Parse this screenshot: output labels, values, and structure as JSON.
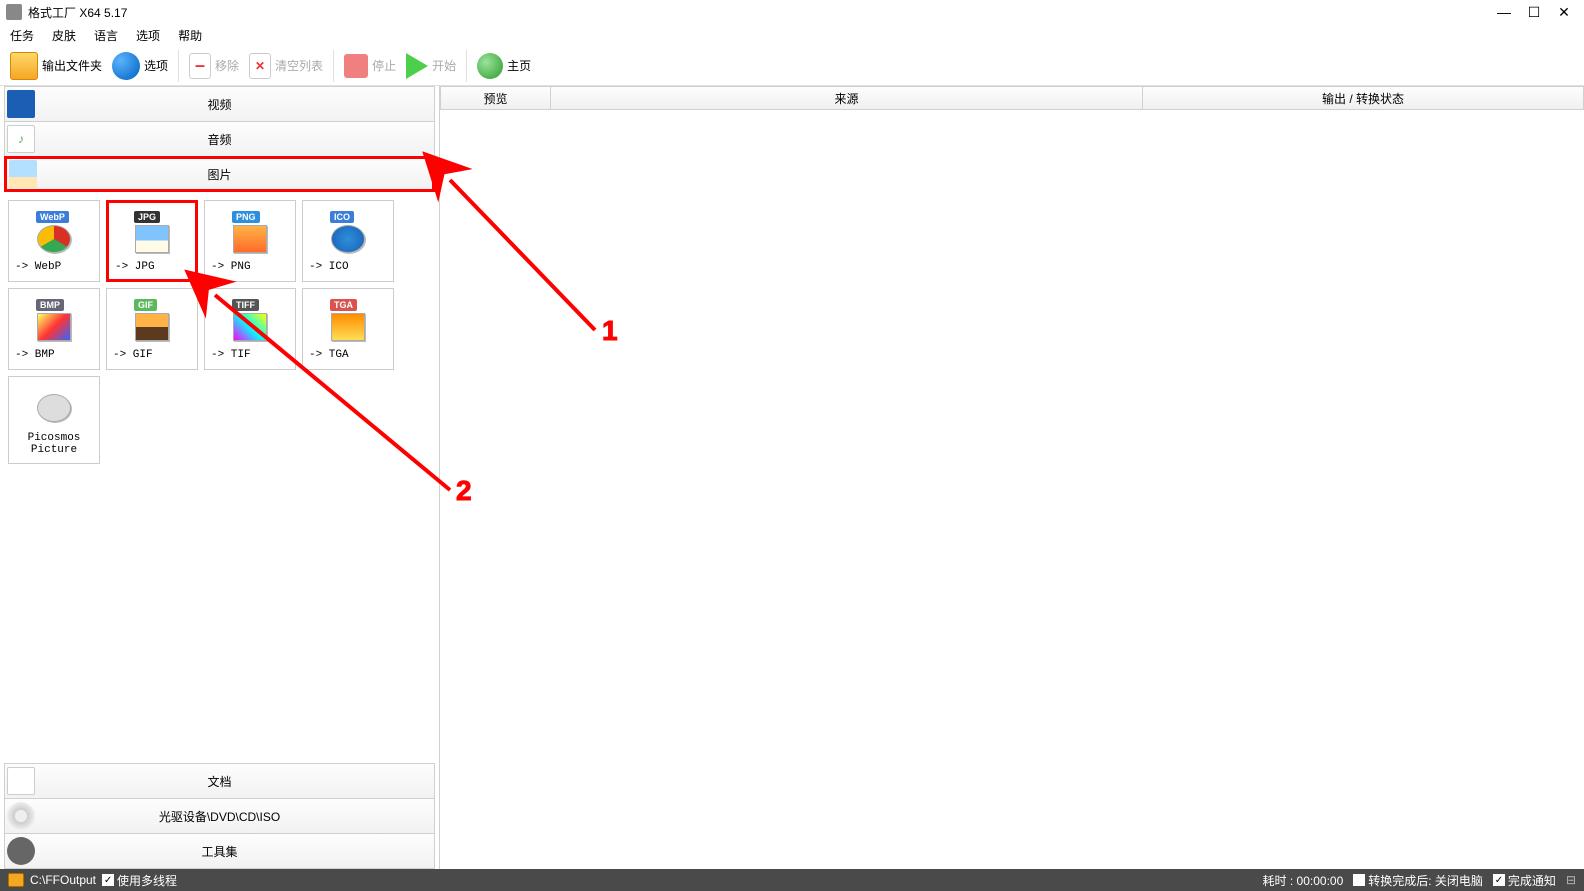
{
  "titlebar": {
    "title": "格式工厂 X64 5.17"
  },
  "menu": {
    "task": "任务",
    "skin": "皮肤",
    "language": "语言",
    "options": "选项",
    "help": "帮助"
  },
  "toolbar": {
    "output_folder": "输出文件夹",
    "options": "选项",
    "remove": "移除",
    "clear_list": "清空列表",
    "stop": "停止",
    "start": "开始",
    "homepage": "主页"
  },
  "accordion": {
    "video": "视频",
    "audio": "音频",
    "image": "图片",
    "document": "文档",
    "disc": "光驱设备\\DVD\\CD\\ISO",
    "tools": "工具集"
  },
  "formats": {
    "webp": "-> WebP",
    "jpg": "-> JPG",
    "png": "-> PNG",
    "ico": "-> ICO",
    "bmp": "-> BMP",
    "gif": "-> GIF",
    "tif": "-> TIF",
    "tga": "-> TGA",
    "picosmos": "Picosmos Picture"
  },
  "badges": {
    "webp": "WebP",
    "jpg": "JPG",
    "png": "PNG",
    "ico": "ICO",
    "bmp": "BMP",
    "gif": "GIF",
    "tiff": "TIFF",
    "tga": "TGA"
  },
  "table": {
    "preview": "预览",
    "source": "来源",
    "status": "输出 / 转换状态"
  },
  "statusbar": {
    "path": "C:\\FFOutput",
    "multithread": "使用多线程",
    "elapsed": "耗时 : 00:00:00",
    "shutdown": "转换完成后: 关闭电脑",
    "notify": "完成通知"
  },
  "annotations": {
    "one": "1",
    "two": "2"
  }
}
